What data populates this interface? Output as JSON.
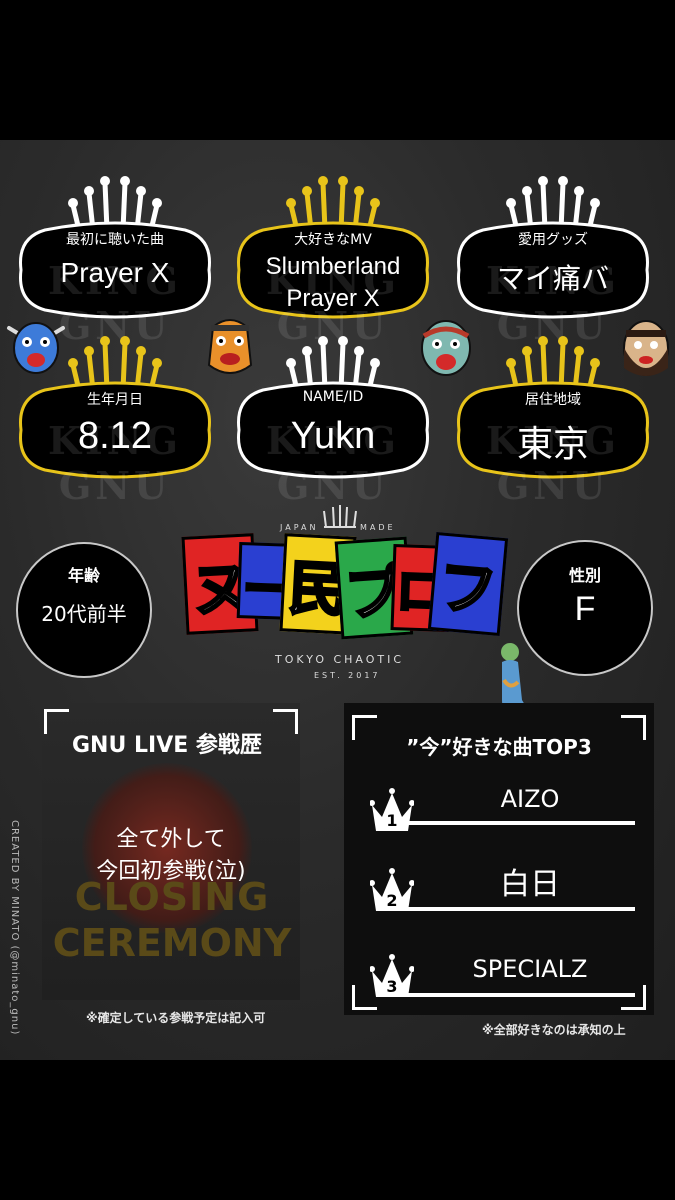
{
  "cards": [
    {
      "label": "最初に聴いた曲",
      "value": "Prayer X"
    },
    {
      "label": "大好きなMV",
      "value_line1": "Slumberland",
      "value_line2": "Prayer X"
    },
    {
      "label": "愛用グッズ",
      "value": "マイ痛バ"
    },
    {
      "label": "生年月日",
      "value": "8.12"
    },
    {
      "label": "NAME/ID",
      "value": "Yukn"
    },
    {
      "label": "居住地域",
      "value": "東京"
    }
  ],
  "badge_watermark": "KING GNU",
  "age": {
    "title": "年齢",
    "value": "20代前半"
  },
  "gender": {
    "title": "性別",
    "value": "F"
  },
  "logo": {
    "top_left": "JAPAN",
    "top_right": "MADE",
    "kana": [
      "ヌ",
      "ー",
      "民",
      "プ",
      "ロ",
      "フ"
    ],
    "subtitle": "TOKYO CHAOTIC",
    "est": "EST. 2017"
  },
  "live": {
    "title": "GNU LIVE 参戦歴",
    "body_line1": "全て外して",
    "body_line2": "今回初参戦(泣)",
    "poster_line1": "CLOSING",
    "poster_line2": "CEREMONY",
    "note": "※確定している参戦予定は記入可"
  },
  "top3": {
    "title": "”今”好きな曲TOP3",
    "songs": [
      "AIZO",
      "白日",
      "SPECIALZ"
    ],
    "ranks": [
      "1",
      "2",
      "3"
    ],
    "note": "※全部好きなのは承知の上"
  },
  "credit": "CREATED BY MINATO (@minato_gnu)",
  "colors": {
    "gold": "#e8c41a",
    "white": "#ffffff",
    "board": "#2b2b2b"
  }
}
